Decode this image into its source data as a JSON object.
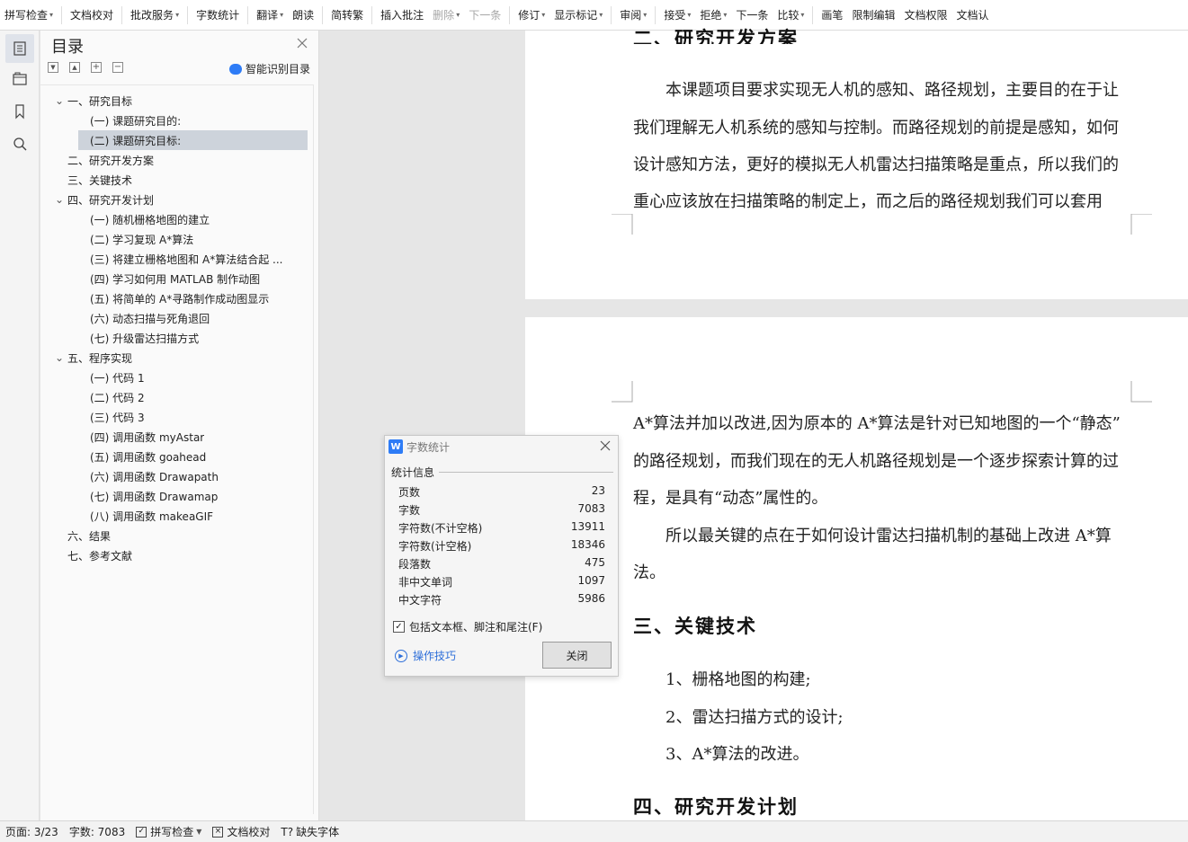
{
  "toolbar": {
    "items": [
      {
        "label": "拼写检查",
        "caret": true,
        "disabled": false
      },
      {
        "label": "文档校对",
        "caret": false,
        "disabled": false
      },
      {
        "label": "批改服务",
        "caret": true,
        "disabled": false
      },
      {
        "label": "字数统计",
        "caret": false,
        "disabled": false
      },
      {
        "label": "翻译",
        "caret": true,
        "disabled": false
      },
      {
        "label": "朗读",
        "caret": false,
        "disabled": false
      },
      {
        "label": "简转繁",
        "caret": false,
        "disabled": false
      },
      {
        "label": "插入批注",
        "caret": false,
        "disabled": false
      },
      {
        "label": "删除",
        "caret": true,
        "disabled": true
      },
      {
        "label": "下一条",
        "caret": false,
        "disabled": true
      },
      {
        "label": "修订",
        "caret": true,
        "disabled": false
      },
      {
        "label": "显示标记",
        "caret": true,
        "disabled": false
      },
      {
        "label": "审阅",
        "caret": true,
        "disabled": false
      },
      {
        "label": "接受",
        "caret": true,
        "disabled": false
      },
      {
        "label": "拒绝",
        "caret": true,
        "disabled": false
      },
      {
        "label": "下一条",
        "caret": false,
        "disabled": false
      },
      {
        "label": "比较",
        "caret": true,
        "disabled": false
      },
      {
        "label": "画笔",
        "caret": false,
        "disabled": false
      },
      {
        "label": "限制编辑",
        "caret": false,
        "disabled": false
      },
      {
        "label": "文档权限",
        "caret": false,
        "disabled": false
      },
      {
        "label": "文档认",
        "caret": false,
        "disabled": false
      }
    ]
  },
  "toc": {
    "title": "目录",
    "smart_label": "智能识别目录",
    "items": [
      {
        "label": "一、研究目标",
        "level": 1,
        "expanded": true
      },
      {
        "label": "(一) 课题研究目的:",
        "level": 2
      },
      {
        "label": "(二) 课题研究目标:",
        "level": 2,
        "selected": true
      },
      {
        "label": "二、研究开发方案",
        "level": 1
      },
      {
        "label": "三、关键技术",
        "level": 1
      },
      {
        "label": "四、研究开发计划",
        "level": 1,
        "expanded": true
      },
      {
        "label": "(一) 随机栅格地图的建立",
        "level": 2
      },
      {
        "label": "(二) 学习复现 A*算法",
        "level": 2
      },
      {
        "label": "(三) 将建立栅格地图和 A*算法结合起 ...",
        "level": 2
      },
      {
        "label": "(四) 学习如何用 MATLAB 制作动图",
        "level": 2
      },
      {
        "label": "(五) 将简单的 A*寻路制作成动图显示",
        "level": 2
      },
      {
        "label": "(六) 动态扫描与死角退回",
        "level": 2
      },
      {
        "label": "(七) 升级雷达扫描方式",
        "level": 2
      },
      {
        "label": "五、程序实现",
        "level": 1,
        "expanded": true
      },
      {
        "label": "(一) 代码 1",
        "level": 2
      },
      {
        "label": "(二) 代码 2",
        "level": 2
      },
      {
        "label": "(三) 代码 3",
        "level": 2
      },
      {
        "label": "(四) 调用函数 myAstar",
        "level": 2
      },
      {
        "label": "(五) 调用函数 goahead",
        "level": 2
      },
      {
        "label": "(六) 调用函数 Drawapath",
        "level": 2
      },
      {
        "label": "(七) 调用函数 Drawamap",
        "level": 2
      },
      {
        "label": "(八) 调用函数 makeaGIF",
        "level": 2
      },
      {
        "label": "六、结果",
        "level": 1
      },
      {
        "label": "七、参考文献",
        "level": 1
      }
    ]
  },
  "document": {
    "page1": {
      "heading": "二、研究开发方案",
      "lines": [
        "本课题项目要求实现无人机的感知、路径规划，主要目的在于让",
        "我们理解无人机系统的感知与控制。而路径规划的前提是感知，如何",
        "设计感知方法，更好的模拟无人机雷达扫描策略是重点，所以我们的",
        "重心应该放在扫描策略的制定上，而之后的路径规划我们可以套用"
      ]
    },
    "page2": {
      "lines": [
        "A*算法并加以改进,因为原本的 A*算法是针对已知地图的一个“静态”",
        "的路径规划，而我们现在的无人机路径规划是一个逐步探索计算的过",
        "程，是具有“动态”属性的。",
        "所以最关键的点在于如何设计雷达扫描机制的基础上改进 A*算",
        "法。"
      ],
      "heading3": "三、关键技术",
      "list": [
        "1、栅格地图的构建;",
        "2、雷达扫描方式的设计;",
        "3、A*算法的改进。"
      ],
      "heading4": "四、研究开发计划"
    }
  },
  "dialog": {
    "title": "字数统计",
    "logo": "W",
    "section": "统计信息",
    "stats": [
      {
        "label": "页数",
        "value": "23"
      },
      {
        "label": "字数",
        "value": "7083"
      },
      {
        "label": "字符数(不计空格)",
        "value": "13911"
      },
      {
        "label": "字符数(计空格)",
        "value": "18346"
      },
      {
        "label": "段落数",
        "value": "475"
      },
      {
        "label": "非中文单词",
        "value": "1097"
      },
      {
        "label": "中文字符",
        "value": "5986"
      }
    ],
    "checkbox_label": "包括文本框、脚注和尾注(F)",
    "checkbox_checked": true,
    "tips_label": "操作技巧",
    "close_label": "关闭"
  },
  "status": {
    "page": "页面: 3/23",
    "words": "字数: 7083",
    "spell": "拼写检查",
    "proof": "文档校对",
    "font": "缺失字体"
  }
}
